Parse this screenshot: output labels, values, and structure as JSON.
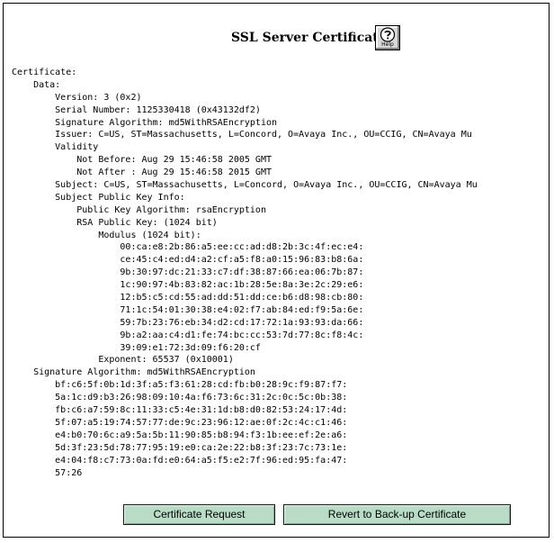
{
  "page": {
    "title": "SSL Server Certificate",
    "help_label": "Help"
  },
  "certificate": {
    "lines": [
      "Certificate:",
      "    Data:",
      "        Version: 3 (0x2)",
      "        Serial Number: 1125330418 (0x43132df2)",
      "        Signature Algorithm: md5WithRSAEncryption",
      "        Issuer: C=US, ST=Massachusetts, L=Concord, O=Avaya Inc., OU=CCIG, CN=Avaya Mu",
      "        Validity",
      "            Not Before: Aug 29 15:46:58 2005 GMT",
      "            Not After : Aug 29 15:46:58 2015 GMT",
      "        Subject: C=US, ST=Massachusetts, L=Concord, O=Avaya Inc., OU=CCIG, CN=Avaya Mu",
      "        Subject Public Key Info:",
      "            Public Key Algorithm: rsaEncryption",
      "            RSA Public Key: (1024 bit)",
      "                Modulus (1024 bit):",
      "                    00:ca:e8:2b:86:a5:ee:cc:ad:d8:2b:3c:4f:ec:e4:",
      "                    ce:45:c4:ed:d4:a2:cf:a5:f8:a0:15:96:83:b8:6a:",
      "                    9b:30:97:dc:21:33:c7:df:38:87:66:ea:06:7b:87:",
      "                    1c:90:97:4b:83:82:ac:1b:28:5e:8a:3e:2c:29:e6:",
      "                    12:b5:c5:cd:55:ad:dd:51:dd:ce:b6:d8:98:cb:80:",
      "                    71:1c:54:01:30:38:e4:02:f7:ab:84:ed:f9:5a:6e:",
      "                    59:7b:23:76:eb:34:d2:cd:17:72:1a:93:93:da:66:",
      "                    9b:a2:aa:c4:d1:fe:74:bc:cc:53:7d:77:8c:f8:4c:",
      "                    39:09:e1:72:3d:09:f6:20:cf",
      "                Exponent: 65537 (0x10001)",
      "    Signature Algorithm: md5WithRSAEncryption",
      "        bf:c6:5f:0b:1d:3f:a5:f3:61:28:cd:fb:b0:28:9c:f9:87:f7:",
      "        5a:1c:d9:b3:26:98:09:10:4a:f6:73:6c:31:2c:0c:5c:0b:38:",
      "        fb:c6:a7:59:8c:11:33:c5:4e:31:1d:b8:d0:82:53:24:17:4d:",
      "        5f:07:a5:19:74:57:77:de:9c:23:96:12:ae:0f:2c:4c:c1:46:",
      "        e4:b0:70:6c:a9:5a:5b:11:90:85:b8:94:f3:1b:ee:ef:2e:a6:",
      "        5d:3f:23:5d:78:77:95:19:e0:ca:2e:22:b8:3f:23:7c:73:1e:",
      "        e4:04:f8:c7:73:0a:fd:e0:64:a5:f5:e2:7f:96:ed:95:fa:47:",
      "        57:26"
    ]
  },
  "actions": {
    "certificate_request": "Certificate Request",
    "revert_backup": "Revert to Back-up Certificate"
  }
}
